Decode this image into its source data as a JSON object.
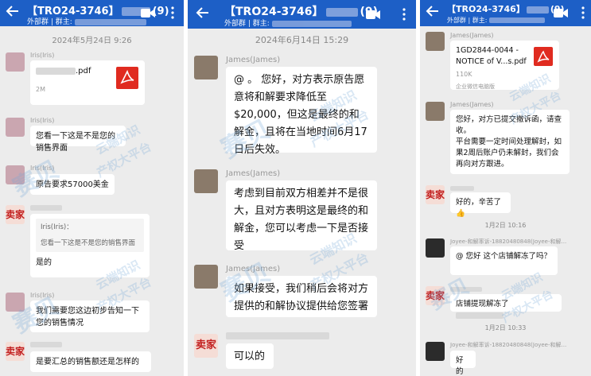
{
  "panel1": {
    "title": "【TRO24-3746】",
    "count": "(9)",
    "sub": "外部群 | 群主:",
    "timestamp": "2024年5月24日 9:26",
    "msg1_name": "Iris(Iris)",
    "file_name": ".pdf",
    "file_size": "2M",
    "msg2_name": "Iris(Iris)",
    "msg2_text": "您看一下这是不是您的销售界面",
    "msg3_name": "Iris(Iris)",
    "msg3_text": "原告要求57000美金",
    "seller": "卖家",
    "quote_name": "Iris(Iris)：",
    "quote_text": "您看一下这是不是您的销售界面",
    "reply_text": "是的",
    "msg5_name": "Iris(Iris)",
    "msg5_text": "我们需要您这边初步告知一下您的销售情况",
    "msg6_text": "是要汇总的销售额还是怎样的"
  },
  "panel2": {
    "title": "【TRO24-3746】",
    "count": "(9)",
    "sub": "外部群 | 群主:",
    "timestamp": "2024年6月14日 15:29",
    "msg1_name": "James(James)",
    "msg1_text": "@          。 您好，对方表示原告愿意将和解要求降低至$20,000，但这是最终的和解金，且将在当地时间6月17日后失效。",
    "msg2_name": "James(James)",
    "msg2_text": "考虑到目前双方相差并不是很大，且对方表明这是最终的和解金，您可以考虑一下是否接受",
    "msg3_name": "James(James)",
    "msg3_text": "如果接受，我们稍后会将对方提供的和解协议提供给您签署",
    "seller": "卖家",
    "msg4_text": "可以的"
  },
  "panel3": {
    "title": "【TRO24-3746】",
    "count": "(9)",
    "sub": "外部群 | 群主:",
    "msg1_name": "James(James)",
    "file_name": "1GD2844-0044 - NOTICE of V...s.pdf",
    "file_size": "110K",
    "file_source": "企业微信电脑版",
    "msg2_name": "James(James)",
    "msg2_text": "您好，对方已提交撤诉函，请查收。\n平台需要一定时间处理解封，如果2周后账户仍未解封，我们会再向对方跟进。",
    "seller": "卖家",
    "msg3_text": "好的，辛苦了👍",
    "timestamp1": "1月2日 10:16",
    "msg4_name": "Joyee-和解率诉-18820480848(Joyee-和解...",
    "msg4_text": "@         您好  这个店铺解冻了吗？",
    "msg5_text": "店铺提现解冻了",
    "timestamp2": "1月2日 10:33",
    "msg6_name": "Joyee-和解率诉-18820480848(Joyee-和解...",
    "msg6_text": "好的"
  },
  "watermark": {
    "brand": "赛贝",
    "line1": "云端知识",
    "line2": "产权大平台"
  },
  "colors": {
    "header": "#1d5fc6",
    "bg": "#ececec",
    "seller": "#c21f1f",
    "pdf": "#e02b20"
  },
  "icons": [
    "back-arrow-icon",
    "video-call-icon",
    "more-vertical-icon",
    "pdf-file-icon"
  ]
}
